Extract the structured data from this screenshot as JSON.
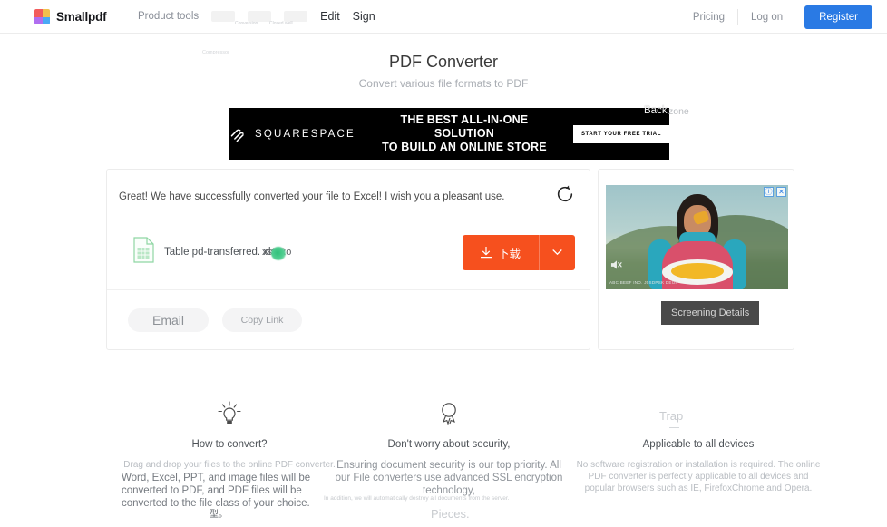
{
  "header": {
    "brand": "Smallpdf",
    "brand_colors": [
      "#f25c5c",
      "#f2c14e",
      "#7bd389",
      "#b06ef0",
      "#49a9f5",
      "#ef5ea8",
      "#5ad1c8",
      "#f59f3b"
    ],
    "nav_left": [
      {
        "label": "Product tools",
        "kind": "muted"
      },
      {
        "label": "Edit",
        "kind": "strong"
      },
      {
        "label": "Sign",
        "kind": "strong"
      }
    ],
    "ghost_labels": [
      "Conversion",
      "Closed well"
    ],
    "nav_right": [
      {
        "label": "Pricing"
      },
      {
        "label": "Log on"
      }
    ],
    "register_label": "Register",
    "register_color": "#2a7ae4"
  },
  "hero": {
    "title": "PDF Converter",
    "subtitle": "Convert various file formats to PDF",
    "ghost_compressor": "Compressor"
  },
  "banner": {
    "brand": "SQUARESPACE",
    "line1": "THE BEST ALL-IN-ONE SOLUTION",
    "line2": "TO BUILD AN ONLINE STORE",
    "cta": "START YOUR FREE TRIAL",
    "overlay_back": "Back",
    "overlay_zone": "zone",
    "bg_color": "#000000"
  },
  "result": {
    "message": "Great! We have successfully converted your file to Excel! I wish you a pleasant use.",
    "restart_icon": "restart-icon",
    "file_name": "Table pd-transferred. xls",
    "file_overlay_text": "xsPRo",
    "download_label": "下载",
    "download_icon": "download-icon",
    "download_color": "#f6501e",
    "caret_icon": "chevron-down-icon",
    "email_label": "Email",
    "copy_link_label": "Copy Link"
  },
  "ad": {
    "badge_info": "ⓘ",
    "badge_close": "✕",
    "mute_icon": "mute-icon",
    "fineprint": "ABC BEEF INO. J0SDPSK DEOP",
    "overlay_button": "Screening Details",
    "ghost_text": "Details"
  },
  "features": [
    {
      "icon": "lightbulb-icon",
      "title": "How to convert?",
      "body": "Drag and drop your files to the online PDF converter.",
      "overlay": "Word, Excel, PPT, and image files will be converted to PDF, and PDF files will be converted to the file class of your choice.",
      "cjk": "型。"
    },
    {
      "icon": "ribbon-icon",
      "title": "Don't worry about security,",
      "body": "Ensuring document security is our top priority. All our File converters use advanced SSL encryption technology,",
      "faint": "In addition, we will automatically destroy all documents from the server.",
      "ghost": "Pieces."
    },
    {
      "icon": "",
      "title": "Applicable to all devices",
      "body": "No software registration or installation is required. The online PDF converter is perfectly applicable to all devices and popular browsers such as IE, FirefoxChrome and Opera.",
      "ghost_title": "Trap"
    }
  ]
}
